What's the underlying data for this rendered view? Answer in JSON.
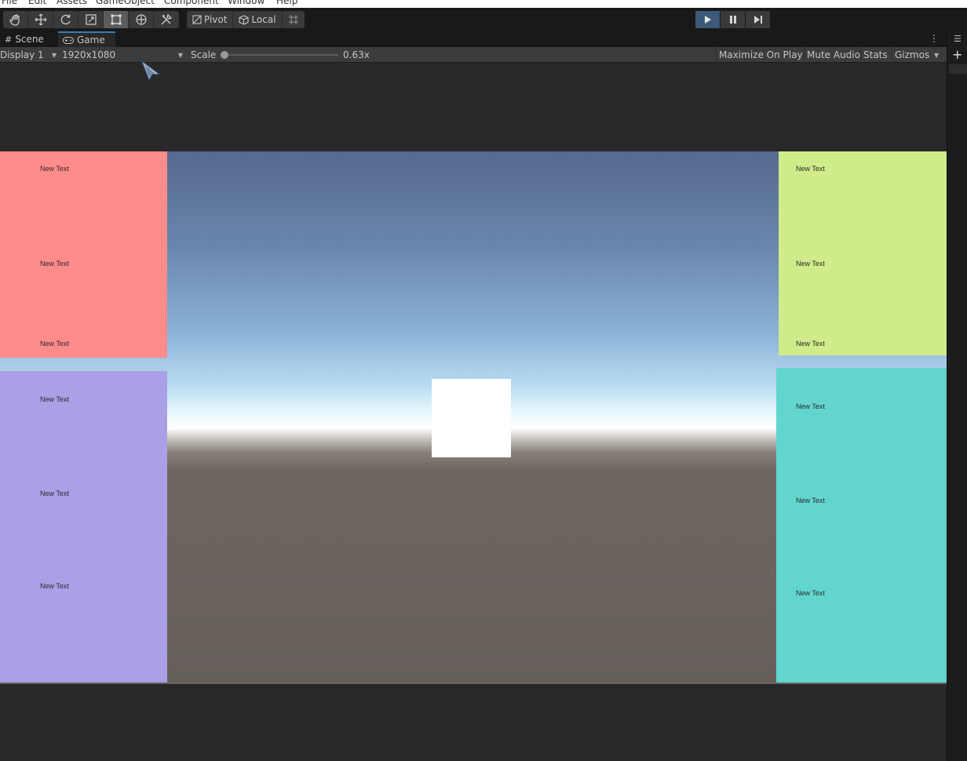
{
  "menu": {
    "items": [
      {
        "label": "File"
      },
      {
        "label": "Edit"
      },
      {
        "label": "Assets"
      },
      {
        "label": "GameObject"
      },
      {
        "label": "Component"
      },
      {
        "label": "Window"
      },
      {
        "label": "Help"
      }
    ]
  },
  "toolbar": {
    "tools": [
      {
        "icon": "hand-tool-icon"
      },
      {
        "icon": "move-tool-icon"
      },
      {
        "icon": "rotate-tool-icon"
      },
      {
        "icon": "scale-tool-icon"
      },
      {
        "icon": "rect-tool-icon",
        "active": true
      },
      {
        "icon": "transform-tool-icon"
      },
      {
        "icon": "custom-tool-icon"
      }
    ],
    "pivot_label": "Pivot",
    "local_label": "Local",
    "grid_snap_icon": "grid-snap-icon",
    "play": {
      "icon": "play-icon",
      "active": true
    },
    "pause": {
      "icon": "pause-icon"
    },
    "step": {
      "icon": "step-icon"
    }
  },
  "tabs": {
    "scene_label": "Scene",
    "game_label": "Game",
    "active": "Game"
  },
  "game_bar": {
    "display_label": "Display 1",
    "resolution_label": "1920x1080",
    "scale_label": "Scale",
    "scale_value": "0.63x",
    "scale_slider_fraction": 0.0,
    "maximize_label": "Maximize On Play",
    "mute_label": "Mute Audio",
    "stats_label": "Stats",
    "gizmos_label": "Gizmos"
  },
  "game_view": {
    "panels": [
      {
        "name": "top-left",
        "color": "#ff8c8a",
        "texts": [
          "New Text",
          "New Text",
          "New Text"
        ]
      },
      {
        "name": "bottom-left",
        "color": "#ab9fe6",
        "texts": [
          "New Text",
          "New Text",
          "New Text"
        ]
      },
      {
        "name": "top-right",
        "color": "#d0ec8a",
        "texts": [
          "New Text",
          "New Text",
          "New Text"
        ]
      },
      {
        "name": "bottom-right",
        "color": "#62d6ce",
        "texts": [
          "New Text",
          "New Text",
          "New Text"
        ]
      }
    ],
    "cube_color": "#ffffff"
  }
}
